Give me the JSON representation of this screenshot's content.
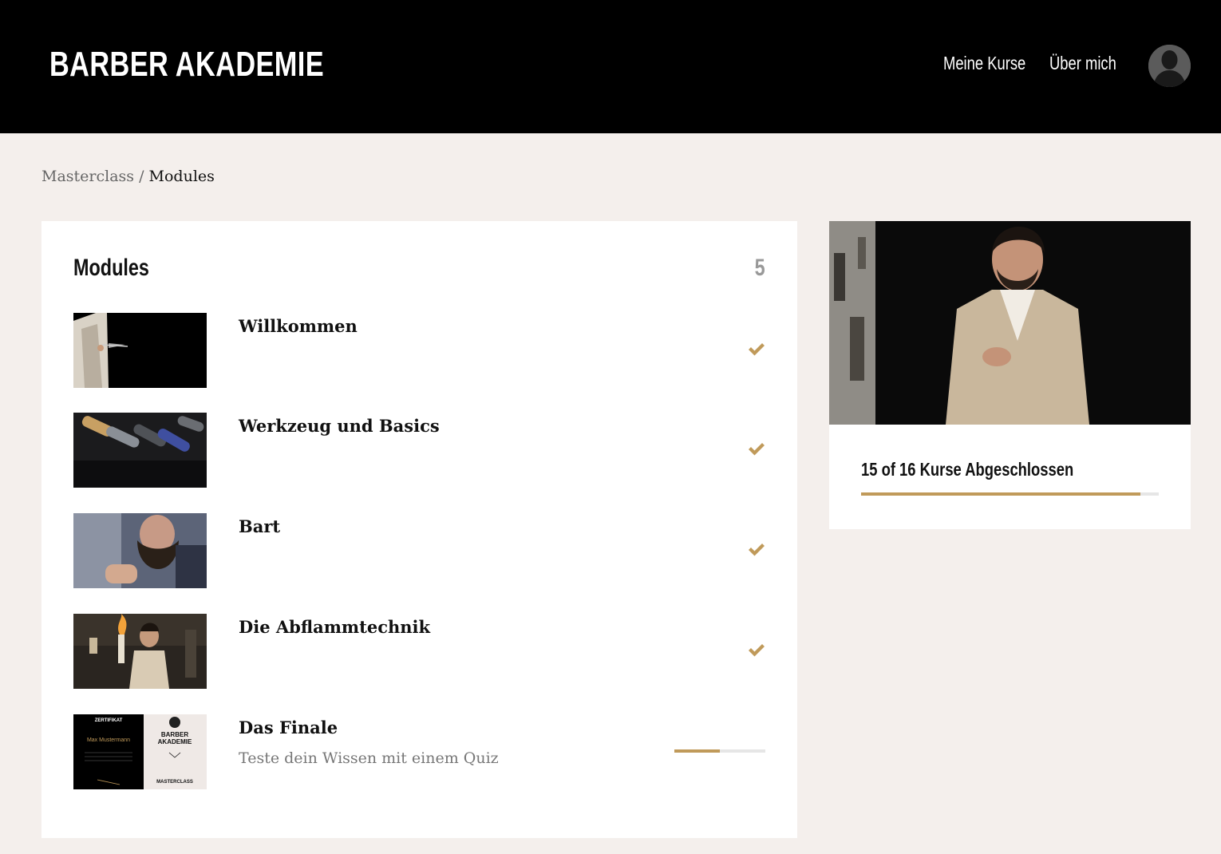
{
  "header": {
    "logo": "BARBER AKADEMIE",
    "nav": [
      {
        "label": "Meine Kurse"
      },
      {
        "label": "Über mich"
      }
    ]
  },
  "breadcrumb": {
    "parent": "Masterclass",
    "separator": " / ",
    "current": "Modules"
  },
  "modules": {
    "title": "Modules",
    "count": "5",
    "items": [
      {
        "title": "Willkommen",
        "subtitle": "",
        "status": "completed"
      },
      {
        "title": "Werkzeug und Basics",
        "subtitle": "",
        "status": "completed"
      },
      {
        "title": "Bart",
        "subtitle": "",
        "status": "completed"
      },
      {
        "title": "Die Abflammtechnik",
        "subtitle": "",
        "status": "completed"
      },
      {
        "title": "Das Finale",
        "subtitle": "Teste dein Wissen mit einem Quiz",
        "status": "in-progress",
        "progress": 0.5
      }
    ]
  },
  "course": {
    "progress_text": "15 of 16 Kurse Abgeschlossen",
    "completed": 15,
    "total": 16
  },
  "thumbnail_texts": {
    "zertifikat": "ZERTIFIKAT",
    "name": "Max Mustermann",
    "brand_line1": "BARBER",
    "brand_line2": "AKADEMIE",
    "masterclass": "MASTERCLASS"
  },
  "icons": {
    "check": "check-icon",
    "avatar": "user-avatar-icon"
  },
  "colors": {
    "accent": "#c09a5a",
    "header_bg": "#000000",
    "page_bg": "#f4efec",
    "track": "#e6e6e6"
  }
}
